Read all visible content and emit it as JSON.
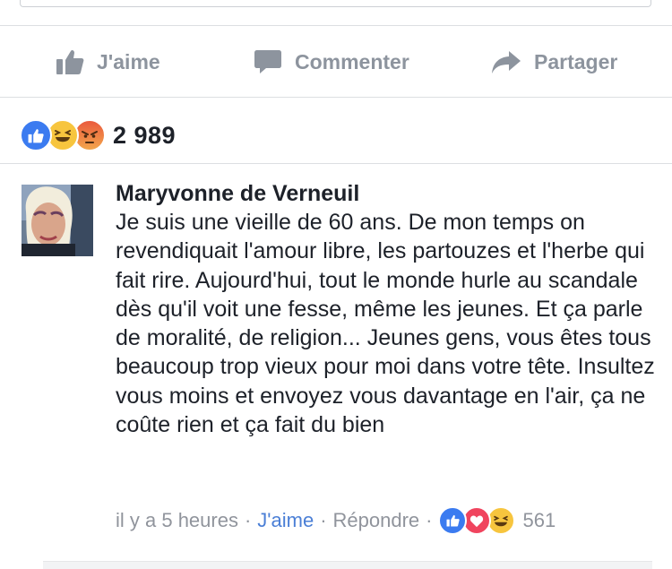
{
  "actions": {
    "like": "J'aime",
    "comment": "Commenter",
    "share": "Partager"
  },
  "reactions": {
    "icons": [
      "like-icon",
      "haha-icon",
      "angry-icon"
    ],
    "count": "2 989"
  },
  "comment": {
    "author": "Maryvonne de Verneuil",
    "text": "Je suis une vieille de 60 ans. De mon temps on revendiquait l'amour libre, les partouzes et l'herbe qui fait rire. Aujourd'hui, tout le monde hurle au scandale dès qu'il voit une fesse, même les jeunes. Et ça parle de moralité, de religion... Jeunes gens, vous êtes tous beaucoup trop vieux pour moi dans votre tête. Insultez vous moins et envoyez vous davantage en l'air, ça ne coûte rien et ça fait du bien",
    "time": "il y a 5 heures",
    "like_label": "J'aime",
    "reply_label": "Répondre",
    "separator": "·",
    "reaction_icons": [
      "like-icon",
      "love-icon",
      "haha-icon"
    ],
    "reaction_count": "561"
  },
  "colors": {
    "action_gray": "#8d949e",
    "link_blue": "#4b7fd6",
    "like_blue": "#3b7bf0",
    "love_red": "#f0445e",
    "haha_yellow": "#f7c53e",
    "angry_red": "#ea5a3d"
  }
}
